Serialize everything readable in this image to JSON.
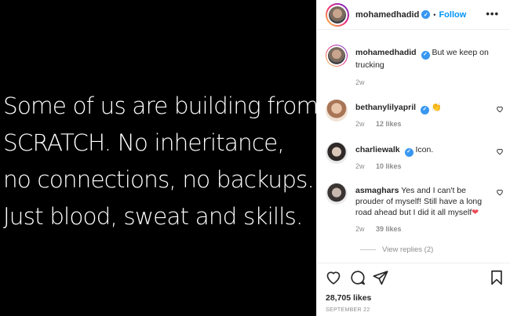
{
  "post": {
    "quote_lines": [
      "Some of us are building from",
      "SCRATCH. No inheritance,",
      "no connections, no backups.",
      "Just blood, sweat and skills."
    ]
  },
  "header": {
    "username": "mohamedhadid",
    "separator": "•",
    "follow_label": "Follow",
    "more_label": "•••"
  },
  "caption": {
    "username": "mohamedhadid",
    "text": "But we keep on trucking",
    "time": "2w"
  },
  "comments": [
    {
      "username": "bethanylilyapril",
      "text": "👏",
      "time": "2w",
      "likes": "12 likes"
    },
    {
      "username": "charliewalk",
      "text": "Icon.",
      "time": "2w",
      "likes": "10 likes"
    },
    {
      "username": "asmaghars",
      "text": "Yes and I can't be prouder of myself! Still have a long road ahead but I did it all myself",
      "emoji": "❤",
      "time": "2w",
      "likes": "39 likes"
    }
  ],
  "view_replies": "View replies (2)",
  "likes_count": "28,705 likes",
  "date": "SEPTEMBER 22",
  "colors": {
    "follow": "#0095f6",
    "verified": "#3897f0",
    "heart_emoji": "#ed4956"
  }
}
